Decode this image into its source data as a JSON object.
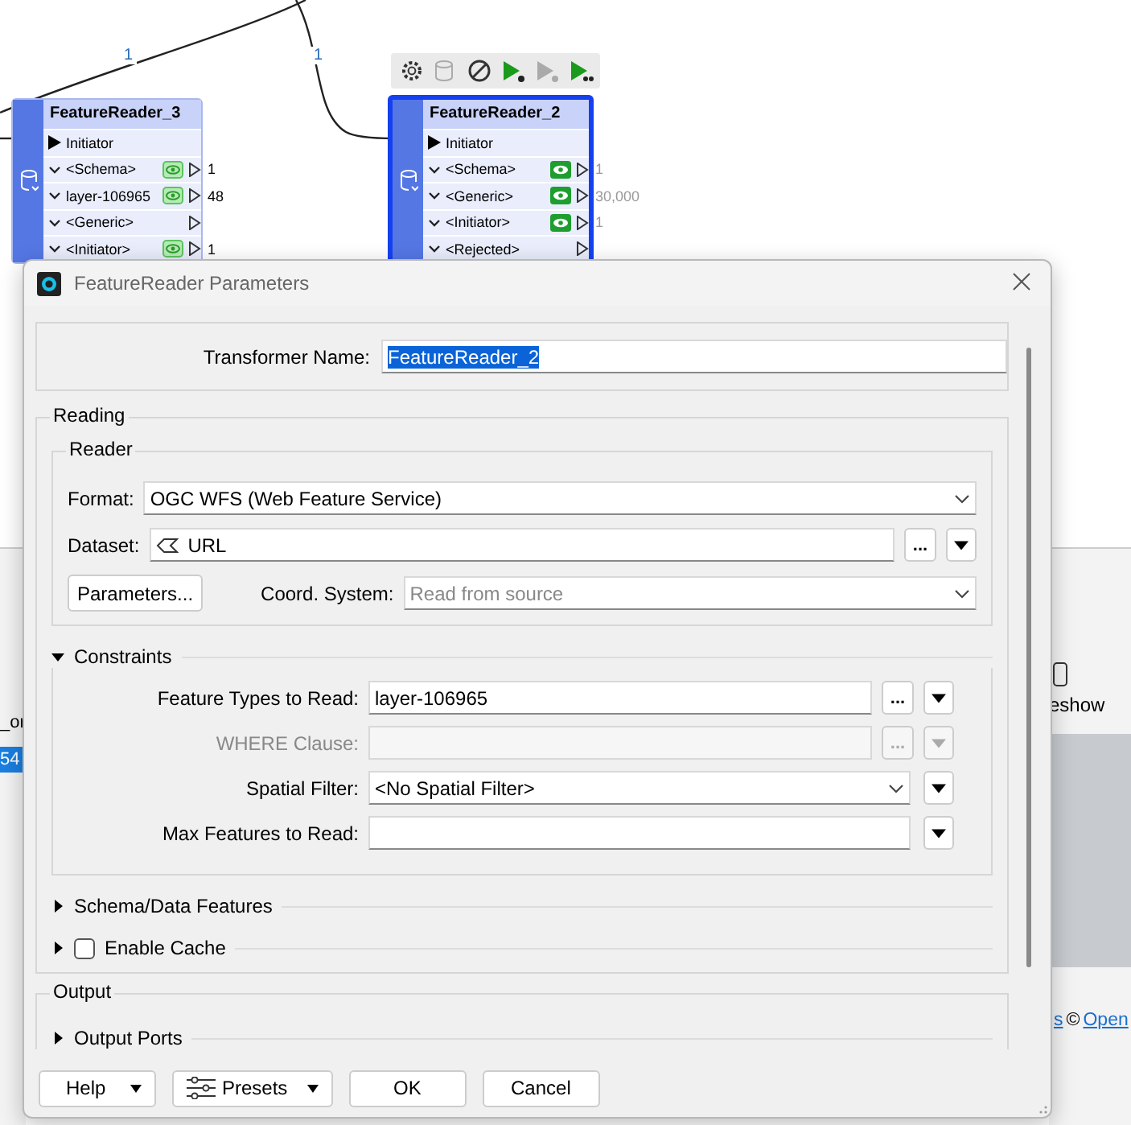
{
  "canvas": {
    "edges": [
      {
        "label": "1"
      },
      {
        "label": "1"
      }
    ],
    "node_toolbar": {
      "buttons": [
        {
          "kind": "gear",
          "disabled": false
        },
        {
          "kind": "cache",
          "disabled": true
        },
        {
          "kind": "disable",
          "disabled": false
        },
        {
          "kind": "run",
          "disabled": false
        },
        {
          "kind": "run",
          "disabled": true
        },
        {
          "kind": "run-to",
          "disabled": false
        }
      ]
    },
    "nodes": [
      {
        "title": "FeatureReader_3",
        "selected": false,
        "input": "Initiator",
        "ports": [
          {
            "name": "<Schema>",
            "kind": "light",
            "count": "1"
          },
          {
            "name": "layer-106965",
            "kind": "light",
            "count": "48"
          },
          {
            "name": "<Generic>",
            "kind": "plain"
          },
          {
            "name": "<Initiator>",
            "kind": "light",
            "count": "1"
          }
        ]
      },
      {
        "title": "FeatureReader_2",
        "selected": true,
        "input": "Initiator",
        "ports": [
          {
            "name": "<Schema>",
            "kind": "solid",
            "count": "1"
          },
          {
            "name": "<Generic>",
            "kind": "solid",
            "count": "30,000"
          },
          {
            "name": "<Initiator>",
            "kind": "solid",
            "count": "1"
          },
          {
            "name": "<Rejected>",
            "kind": "plain"
          }
        ]
      }
    ]
  },
  "background": {
    "left": [
      {
        "text": "_or",
        "selected": false
      },
      {
        "text": "54",
        "selected": true
      }
    ],
    "right_label": "eshow",
    "attribution": [
      "s",
      "©",
      "Open"
    ]
  },
  "dialog": {
    "title": "FeatureReader Parameters",
    "transformer_name": {
      "label": "Transformer Name:",
      "value": "FeatureReader_2",
      "selected": true
    },
    "reading": {
      "title": "Reading",
      "reader": {
        "title": "Reader",
        "format": {
          "label": "Format:",
          "value": "OGC WFS (Web Feature Service)"
        },
        "dataset": {
          "label": "Dataset:",
          "value": "URL",
          "browse": "..."
        },
        "parameters_button": "Parameters...",
        "coord_system": {
          "label": "Coord. System:",
          "placeholder": "Read from source"
        }
      },
      "constraints": {
        "title": "Constraints",
        "expanded": true,
        "fields": [
          {
            "label": "Feature Types to Read:",
            "kind": "text",
            "value": "layer-106965",
            "browse": "...",
            "disabled": false
          },
          {
            "label": "WHERE Clause:",
            "kind": "text",
            "browse": "...",
            "disabled": true
          },
          {
            "label": "Spatial Filter:",
            "kind": "combo",
            "value": "<No Spatial Filter>",
            "disabled": false
          },
          {
            "label": "Max Features to Read:",
            "kind": "combo-edit",
            "disabled": false
          }
        ]
      },
      "sections": [
        {
          "title": "Schema/Data Features",
          "expanded": false,
          "kind": "plain"
        },
        {
          "title": "Enable Cache",
          "expanded": false,
          "kind": "checkbox",
          "checked": false
        }
      ]
    },
    "output": {
      "title": "Output",
      "sections": [
        {
          "title": "Output Ports",
          "expanded": false
        }
      ]
    },
    "buttons": [
      {
        "label": "Help",
        "kind": "menu"
      },
      {
        "label": "Presets",
        "kind": "presets"
      },
      {
        "label": "OK",
        "kind": "plain"
      },
      {
        "label": "Cancel",
        "kind": "plain"
      }
    ]
  }
}
